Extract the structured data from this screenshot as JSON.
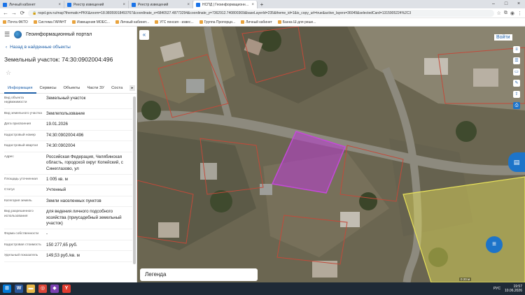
{
  "browser": {
    "tabs": [
      {
        "label": "Личный кабинет",
        "active": false
      },
      {
        "label": "Реестр извещений",
        "active": false
      },
      {
        "label": "Реестр извещений",
        "active": false
      },
      {
        "label": "НСПД | Геоинформационный п",
        "active": true
      }
    ],
    "new_tab": "+",
    "url": "nspd.gov.ru/map?thematic=PKK&zoom=18.98059918493767&coordinate_x=6840527.48773294&coordinate_y=7362912.740800369&baseLayerId=235&theme_id=1&is_copy_url=true&active_layers=36049&selectedCard=1315905224%2C3",
    "bookmarks": [
      "Почта ФКТО",
      "Система ГАРАНТ",
      "Извещения МОЕС...",
      "Личный кабинет...",
      "УГС пенсия - извес...",
      "Группа Пропорци...",
      "Личный кабинет",
      "Банка Ш для реше..."
    ]
  },
  "panel": {
    "portal_title": "Геоинформационный портал",
    "back_label": "Назад в найденные объекты",
    "object_title": "Земельный участок: 74:30:0902004:496",
    "tabs": [
      "Информация",
      "Сервисы",
      "Объекты",
      "Части ЗУ",
      "Соста"
    ],
    "attributes": [
      {
        "key": "Вид объекта недвижимости",
        "value": "Земельный участок"
      },
      {
        "key": "Вид земельного участка",
        "value": "Землепользование"
      },
      {
        "key": "Дата присвоения",
        "value": "19.01.2026"
      },
      {
        "key": "Кадастровый номер",
        "value": "74:30:0902004:496"
      },
      {
        "key": "Кадастровый квартал",
        "value": "74:30:0902004"
      },
      {
        "key": "Адрес",
        "value": "Российская Федерация, Челябинская область, городской округ Копейский, с Синеглазово, ул"
      },
      {
        "key": "Площадь уточненная",
        "value": "1 005 кв. м"
      },
      {
        "key": "Статус",
        "value": "Учтенный"
      },
      {
        "key": "Категория земель",
        "value": "Земли населенных пунктов"
      },
      {
        "key": "Вид разрешенного использования",
        "value": "для ведения личного подсобного хозяйства (приусадебный земельный участок)"
      },
      {
        "key": "Форма собственности",
        "value": "-"
      },
      {
        "key": "Кадастровая стоимость",
        "value": "150 277,65 руб."
      },
      {
        "key": "Удельный показатель",
        "value": "149,53 руб./кв. м"
      }
    ]
  },
  "map": {
    "login_label": "Войти",
    "legend_label": "Легенда",
    "scale_text": "0 20 м",
    "parcel_color": "#b43fc8",
    "zone_color": "#e8e25a"
  },
  "taskbar": {
    "time": "19:57",
    "date": "10.06.2026",
    "lang": "РУС"
  }
}
